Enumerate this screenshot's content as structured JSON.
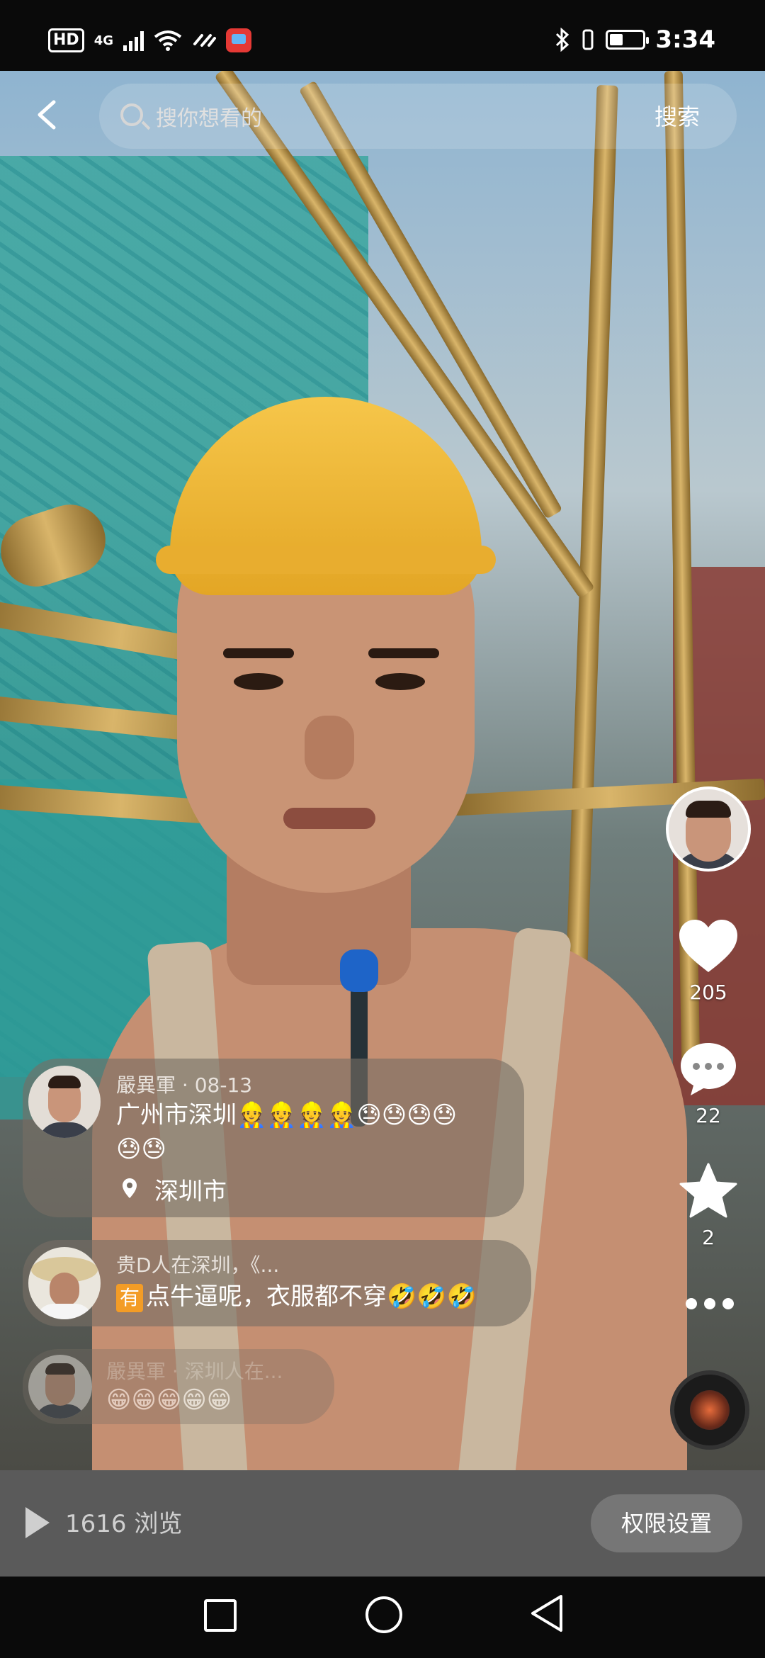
{
  "status_bar": {
    "hd": "HD",
    "network": "4G",
    "time": "3:34",
    "battery_level": 0.4
  },
  "search": {
    "placeholder": "搜你想看的",
    "button": "搜索"
  },
  "rail": {
    "likes": "205",
    "comments": "22",
    "favorites": "2"
  },
  "post": {
    "author": "嚴異軍",
    "date": "08-13",
    "text": "广州市深圳",
    "emojis": "👷👷👷👷😓😓😓😓",
    "emojis_line2": "😓😓",
    "location": "深圳市"
  },
  "comment1": {
    "author": "贵D人在深圳，《...",
    "tag": "有",
    "text": "点牛逼呢，衣服都不穿",
    "emojis": "🤣🤣🤣"
  },
  "comment2": {
    "author": "嚴異軍 · 深圳人在...",
    "emojis": "😁😁😁😁😁"
  },
  "bottom": {
    "views": "1616 浏览",
    "permissions": "权限设置"
  },
  "colors": {
    "card_bg": "#786e64",
    "tag_orange": "#f39c26",
    "bottom_bar": "#5a5a5a"
  }
}
